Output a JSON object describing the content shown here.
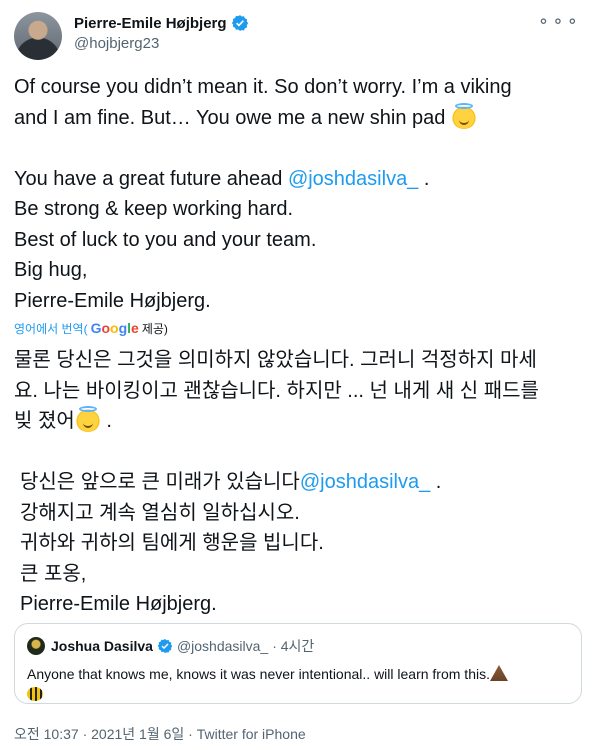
{
  "author": {
    "display_name": "Pierre-Emile Højbjerg",
    "handle": "@hojbjerg23"
  },
  "menu": {
    "more_label": "⚬⚬⚬"
  },
  "tweet": {
    "line1": "Of course you didn’t mean it. So don’t worry. I’m a viking",
    "line2": "and I am fine. But… You owe me a new shin pad",
    "line3_prefix": "You have a great future ahead ",
    "mention": "@joshdasilva_",
    "line3_suffix": " .",
    "line4": "Be strong & keep working hard.",
    "line5": "Best of luck to you and your team.",
    "line6": "Big hug,",
    "line7": "Pierre-Emile Højbjerg.",
    "emoji_name": "smiling-face-with-halo-icon"
  },
  "translation": {
    "label": "영어에서 번역(",
    "google": [
      "G",
      "o",
      "o",
      "g",
      "l",
      "e"
    ],
    "suffix": " 제공)",
    "line1": "물론 당신은 그것을 의미하지 않았습니다. 그러니 걱정하지 마세",
    "line2": "요. 나는 바이킹이고 괜찮습니다. 하지만 ... 넌 내게 새 신 패드를",
    "line3_prefix": "빚 졌어",
    "line3_suffix": " .",
    "line4_prefix": "당신은 앞으로 큰 미래가 있습니다",
    "mention": "@joshdasilva_",
    "line4_suffix": " .",
    "line5": "강해지고 계속 열심히 일하십시오.",
    "line6": "귀하와 귀하의 팀에게 행운을 빕니다.",
    "line7": "큰 포옹,",
    "line8": "Pierre-Emile Højbjerg."
  },
  "quoted": {
    "name": "Joshua Dasilva",
    "handle": "@joshdasilva_",
    "time": "· 4시간",
    "text": "Anyone that knows me, knows it was never intentional.. will learn from this."
  },
  "footer": {
    "meta": "오전 10:37 · 2021년 1월 6일 · Twitter for iPhone"
  },
  "colors": {
    "accent": "#1d9bf0",
    "text": "#0f1419",
    "muted": "#536471"
  }
}
